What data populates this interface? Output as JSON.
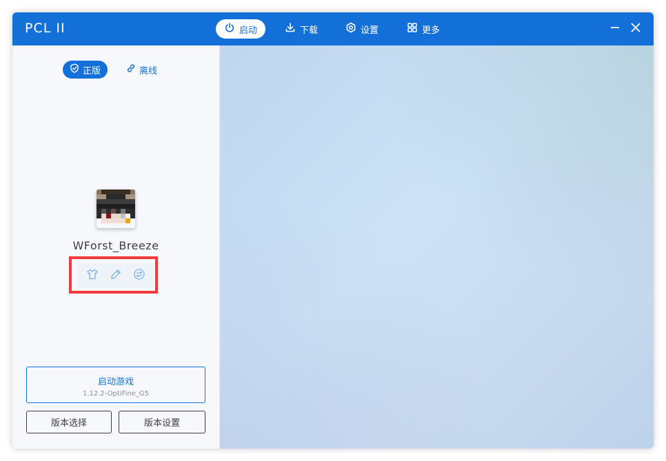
{
  "app": {
    "title": "PCL II"
  },
  "nav": {
    "items": [
      {
        "label": "启动",
        "icon": "power-icon",
        "active": true
      },
      {
        "label": "下载",
        "icon": "download-icon",
        "active": false
      },
      {
        "label": "设置",
        "icon": "gear-icon",
        "active": false
      },
      {
        "label": "更多",
        "icon": "grid-icon",
        "active": false
      }
    ]
  },
  "window_controls": {
    "minimize_icon": "minimize-icon",
    "close_icon": "close-icon"
  },
  "login": {
    "modes": [
      {
        "label": "正版",
        "icon": "shield-check-icon",
        "selected": true
      },
      {
        "label": "离线",
        "icon": "link-icon",
        "selected": false
      }
    ]
  },
  "profile": {
    "username": "WForst_Breeze",
    "actions": [
      {
        "icon": "tshirt-icon"
      },
      {
        "icon": "pencil-icon"
      },
      {
        "icon": "swap-icon"
      }
    ]
  },
  "launch": {
    "title": "启动游戏",
    "version": "1.12.2-OptiFine_G5"
  },
  "buttons": {
    "version_select": "版本选择",
    "version_settings": "版本设置"
  },
  "colors": {
    "accent": "#1370d8",
    "highlight": "#f33a3a",
    "text": "#3a3f46",
    "muted": "#8a919b"
  }
}
